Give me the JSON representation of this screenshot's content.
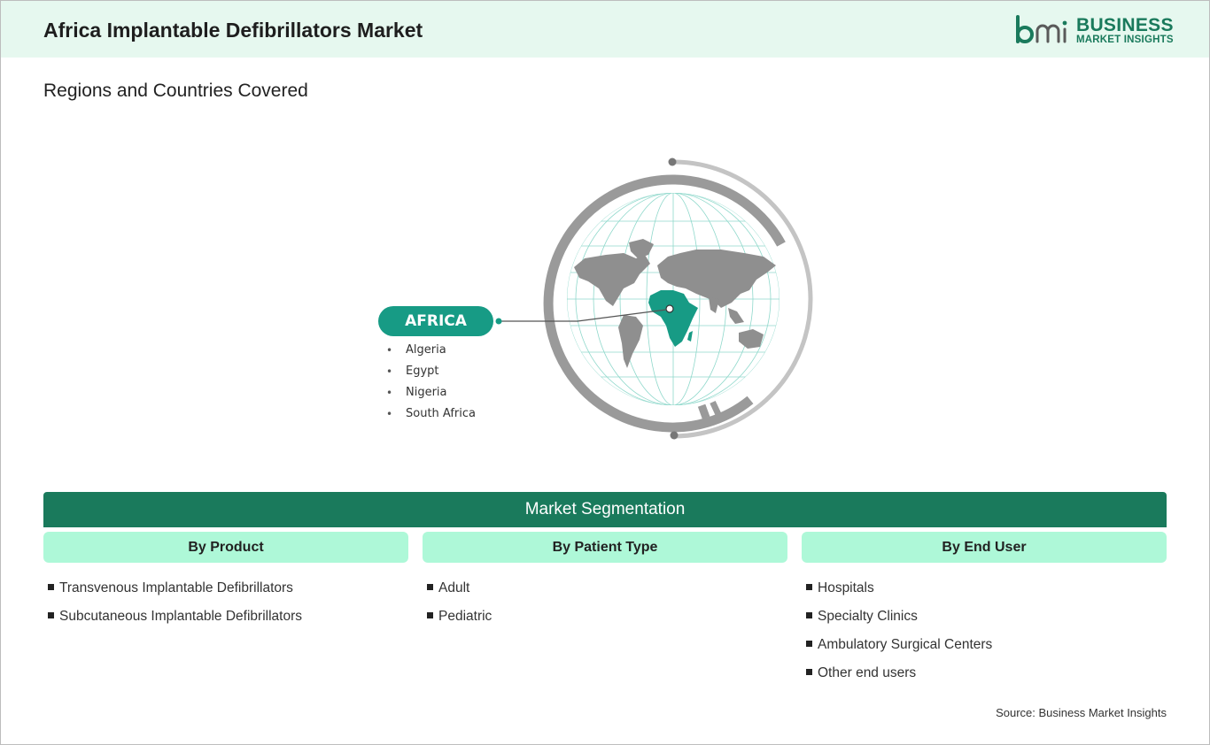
{
  "header": {
    "title": "Africa Implantable Defibrillators Market",
    "logo_line1": "BUSINESS",
    "logo_line2": "MARKET INSIGHTS",
    "logo_color": "#1a7a5c"
  },
  "regions": {
    "subtitle": "Regions and Countries Covered",
    "region_label": "AFRICA",
    "highlight_color": "#179b85",
    "countries": [
      "Algeria",
      "Egypt",
      "Nigeria",
      "South Africa"
    ]
  },
  "segmentation": {
    "title": "Market Segmentation",
    "columns": [
      {
        "heading": "By Product",
        "items": [
          "Transvenous Implantable Defibrillators",
          "Subcutaneous Implantable Defibrillators"
        ]
      },
      {
        "heading": "By Patient Type",
        "items": [
          "Adult",
          "Pediatric"
        ]
      },
      {
        "heading": "By End User",
        "items": [
          "Hospitals",
          "Specialty Clinics",
          "Ambulatory Surgical Centers",
          "Other end users"
        ]
      }
    ]
  },
  "footer": {
    "source": "Source: Business Market Insights"
  }
}
